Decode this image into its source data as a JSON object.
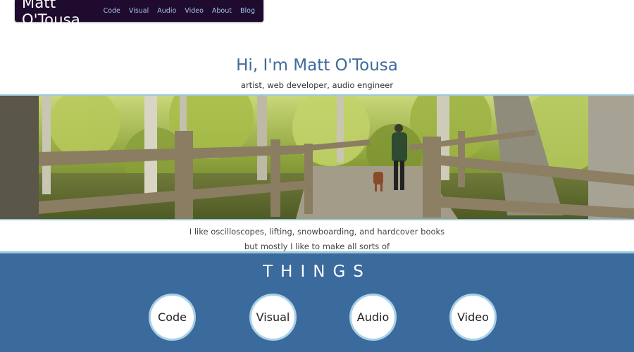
{
  "nav": {
    "brand": "Matt O'Tousa",
    "links": [
      "Code",
      "Visual",
      "Audio",
      "Video",
      "About",
      "Blog"
    ]
  },
  "hero": {
    "title": "Hi, I'm Matt O'Tousa",
    "subtitle": "artist, web developer, audio engineer"
  },
  "intro": {
    "line1": "I like oscilloscopes, lifting, snowboarding, and hardcover books",
    "line2": "but mostly I like to make all sorts of"
  },
  "things": {
    "title": "THINGS",
    "items": [
      "Code",
      "Visual",
      "Audio",
      "Video"
    ]
  },
  "colors": {
    "nav_bg": "#1e0b2e",
    "accent_blue": "#3f6a9c",
    "section_blue": "#3b6a9c",
    "border_light_blue": "#9cc8dc"
  }
}
